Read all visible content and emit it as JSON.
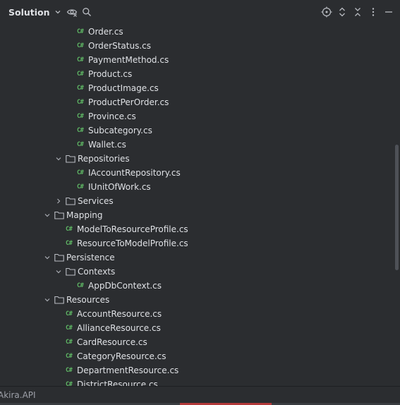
{
  "header": {
    "title": "Solution"
  },
  "tree": {
    "items": [
      {
        "kind": "file",
        "depth": 4,
        "label": "Order.cs"
      },
      {
        "kind": "file",
        "depth": 4,
        "label": "OrderStatus.cs"
      },
      {
        "kind": "file",
        "depth": 4,
        "label": "PaymentMethod.cs"
      },
      {
        "kind": "file",
        "depth": 4,
        "label": "Product.cs"
      },
      {
        "kind": "file",
        "depth": 4,
        "label": "ProductImage.cs"
      },
      {
        "kind": "file",
        "depth": 4,
        "label": "ProductPerOrder.cs"
      },
      {
        "kind": "file",
        "depth": 4,
        "label": "Province.cs"
      },
      {
        "kind": "file",
        "depth": 4,
        "label": "Subcategory.cs"
      },
      {
        "kind": "file",
        "depth": 4,
        "label": "Wallet.cs"
      },
      {
        "kind": "folder",
        "depth": 3,
        "label": "Repositories",
        "expanded": true
      },
      {
        "kind": "file",
        "depth": 4,
        "label": "IAccountRepository.cs"
      },
      {
        "kind": "file",
        "depth": 4,
        "label": "IUnitOfWork.cs"
      },
      {
        "kind": "folder",
        "depth": 3,
        "label": "Services",
        "expanded": false
      },
      {
        "kind": "folder",
        "depth": 2,
        "label": "Mapping",
        "expanded": true
      },
      {
        "kind": "file",
        "depth": 3,
        "label": "ModelToResourceProfile.cs"
      },
      {
        "kind": "file",
        "depth": 3,
        "label": "ResourceToModelProfile.cs"
      },
      {
        "kind": "folder",
        "depth": 2,
        "label": "Persistence",
        "expanded": true
      },
      {
        "kind": "folder",
        "depth": 3,
        "label": "Contexts",
        "expanded": true
      },
      {
        "kind": "file",
        "depth": 4,
        "label": "AppDbContext.cs"
      },
      {
        "kind": "folder",
        "depth": 2,
        "label": "Resources",
        "expanded": true
      },
      {
        "kind": "file",
        "depth": 3,
        "label": "AccountResource.cs"
      },
      {
        "kind": "file",
        "depth": 3,
        "label": "AllianceResource.cs"
      },
      {
        "kind": "file",
        "depth": 3,
        "label": "CardResource.cs"
      },
      {
        "kind": "file",
        "depth": 3,
        "label": "CategoryResource.cs"
      },
      {
        "kind": "file",
        "depth": 3,
        "label": "DepartmentResource.cs"
      },
      {
        "kind": "file",
        "depth": 3,
        "label": "DistrictResource.cs"
      }
    ],
    "file_badge": "C#"
  },
  "status": {
    "text": "Akira.API"
  },
  "colors": {
    "background": "#2b2d30",
    "text": "#dfe1e5",
    "csharp_badge": "#5fb865",
    "accent_bottom": "#b33a3a"
  },
  "icons": {
    "title_dropdown": "chevron-down-icon",
    "visibility": "eye-hidden-icon",
    "search": "search-icon",
    "locate": "crosshair-icon",
    "expand_all": "expand-icon",
    "collapse_all": "collapse-icon",
    "options": "kebab-menu-icon",
    "hide": "minimize-icon"
  }
}
